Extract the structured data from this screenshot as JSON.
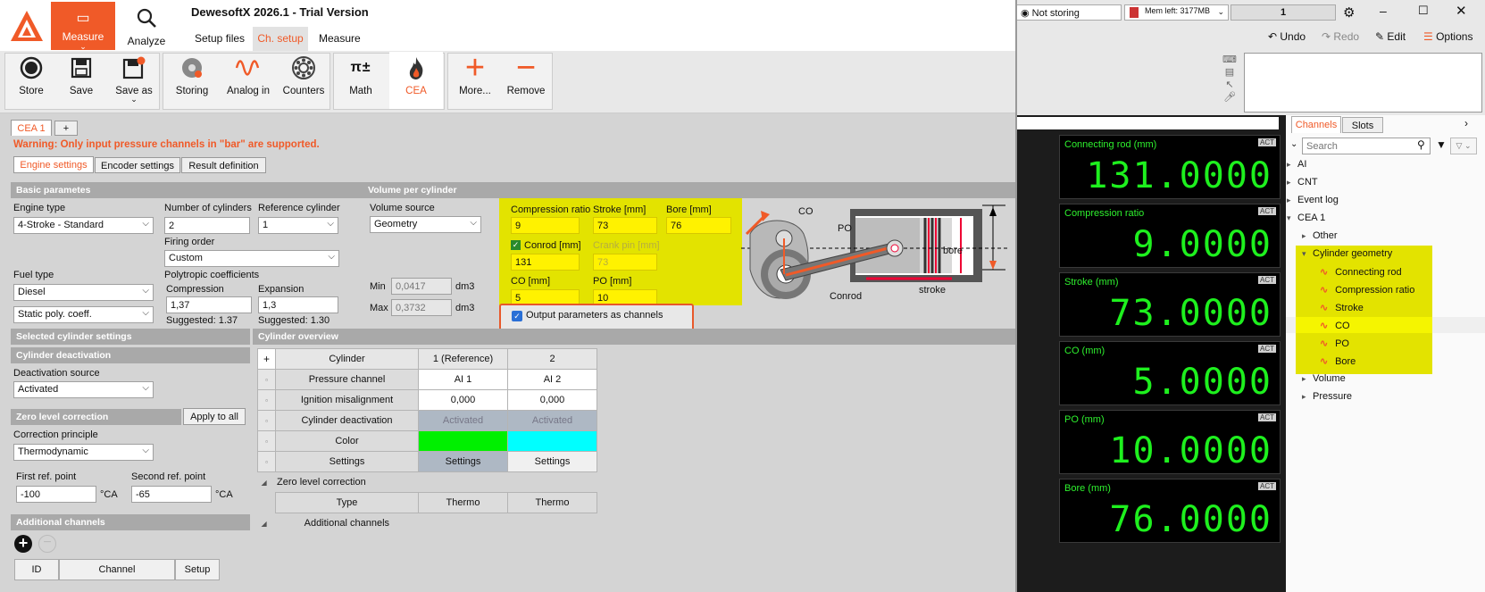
{
  "app": {
    "title": "DewesoftX 2026.1 - Trial Version"
  },
  "mode_tabs": {
    "measure": "Measure",
    "analyze": "Analyze"
  },
  "nav_tabs": [
    "Setup files",
    "Ch. setup",
    "Measure"
  ],
  "status": {
    "storing": "Not storing",
    "mem": "Mem left: 3177MB",
    "counter": "1"
  },
  "actions": {
    "undo": "Undo",
    "redo": "Redo",
    "edit": "Edit",
    "options": "Options"
  },
  "toolbar": [
    "Store",
    "Save",
    "Save as",
    "Storing",
    "Analog in",
    "Counters",
    "Math",
    "CEA",
    "More...",
    "Remove"
  ],
  "doc_tabs": {
    "cea1": "CEA 1",
    "add": "+"
  },
  "warning": "Warning: Only input pressure channels in \"bar\" are supported.",
  "sub_tabs": [
    "Engine settings",
    "Encoder settings",
    "Result definition"
  ],
  "basic": {
    "header": "Basic parametes",
    "engine_type_label": "Engine type",
    "engine_type": "4-Stroke - Standard",
    "num_cyl_label": "Number of cylinders",
    "num_cyl": "2",
    "ref_cyl_label": "Reference cylinder",
    "ref_cyl": "1",
    "firing_label": "Firing order",
    "firing": "Custom",
    "fuel_label": "Fuel type",
    "fuel": "Diesel",
    "poly_mode": "Static poly. coeff.",
    "poly_label": "Polytropic coefficients",
    "compression_label": "Compression",
    "compression": "1,37",
    "expansion_label": "Expansion",
    "expansion": "1,3",
    "sugg_comp": "Suggested: 1.37",
    "sugg_exp": "Suggested: 1.30"
  },
  "volume": {
    "header": "Volume per cylinder",
    "source_label": "Volume source",
    "source": "Geometry",
    "min_label": "Min",
    "min": "0,0417",
    "max_label": "Max",
    "max": "0,3732",
    "unit": "dm3"
  },
  "geometry": {
    "cr_label": "Compression ratio",
    "cr": "9",
    "stroke_label": "Stroke [mm]",
    "stroke": "73",
    "bore_label": "Bore [mm]",
    "bore": "76",
    "conrod_label": "Conrod [mm]",
    "conrod": "131",
    "crankpin_label": "Crank pin [mm]",
    "crankpin": "73",
    "co_label": "CO [mm]",
    "co": "5",
    "po_label": "PO [mm]",
    "po": "10",
    "output_label": "Output parameters as channels"
  },
  "diagram": {
    "co": "CO",
    "po": "PO",
    "bore": "bore",
    "conrod": "Conrod",
    "stroke": "stroke"
  },
  "selected_cyl": {
    "header": "Selected cylinder settings",
    "deact_header": "Cylinder deactivation",
    "deact_source_label": "Deactivation source",
    "deact_source": "Activated",
    "zero_header": "Zero level correction",
    "apply_all": "Apply to all",
    "principle_label": "Correction principle",
    "principle": "Thermodynamic",
    "first_label": "First ref. point",
    "first": "-100",
    "second_label": "Second ref. point",
    "second": "-65",
    "unit": "°CA",
    "add_header": "Additional channels",
    "add_cols": [
      "ID",
      "Channel",
      "Setup"
    ]
  },
  "overview": {
    "header": "Cylinder overview",
    "plus": "+",
    "cols": [
      "Cylinder",
      "1 (Reference)",
      "2"
    ],
    "rows": [
      {
        "label": "Pressure channel",
        "c1": "AI 1",
        "c2": "AI 2"
      },
      {
        "label": "Ignition misalignment",
        "c1": "0,000",
        "c2": "0,000"
      },
      {
        "label": "Cylinder deactivation",
        "c1": "Activated",
        "c2": "Activated"
      },
      {
        "label": "Color",
        "c1": "",
        "c2": ""
      },
      {
        "label": "Settings",
        "c1": "Settings",
        "c2": "Settings"
      }
    ],
    "colors": {
      "c1": "#00f000",
      "c2": "#00ffff"
    },
    "zero_group": "Zero level correction",
    "type_label": "Type",
    "type_c1": "Thermo",
    "type_c2": "Thermo",
    "add_group": "Additional channels"
  },
  "displays": [
    {
      "title": "Connecting rod (mm)",
      "value": "131.0000"
    },
    {
      "title": "Compression ratio",
      "value": "9.0000"
    },
    {
      "title": "Stroke (mm)",
      "value": "73.0000"
    },
    {
      "title": "CO (mm)",
      "value": "5.0000"
    },
    {
      "title": "PO (mm)",
      "value": "10.0000"
    },
    {
      "title": "Bore (mm)",
      "value": "76.0000"
    }
  ],
  "act": "ACT",
  "side_tabs": {
    "channels": "Channels",
    "slots": "Slots"
  },
  "search_placeholder": "Search",
  "tree": {
    "ai": "AI",
    "cnt": "CNT",
    "event": "Event log",
    "cea": "CEA 1",
    "other": "Other",
    "cylgeo": "Cylinder geometry",
    "leaves": [
      "Connecting rod",
      "Compression ratio",
      "Stroke",
      "CO",
      "PO",
      "Bore"
    ],
    "volume": "Volume",
    "pressure": "Pressure"
  },
  "colors": {
    "accent": "#f05a28",
    "highlight": "#e3e300",
    "display_fg": "#1ef01e"
  }
}
